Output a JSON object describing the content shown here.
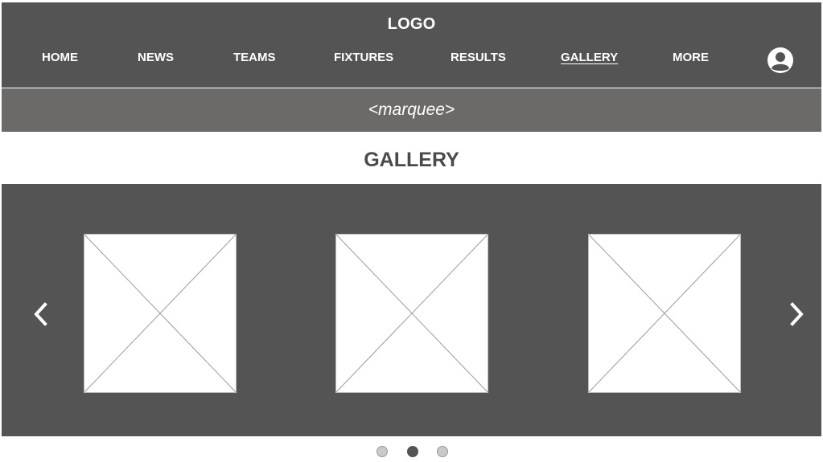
{
  "header": {
    "logo": "LOGO",
    "nav": [
      {
        "label": "HOME",
        "active": false
      },
      {
        "label": "NEWS",
        "active": false
      },
      {
        "label": "TEAMS",
        "active": false
      },
      {
        "label": "FIXTURES",
        "active": false
      },
      {
        "label": "RESULTS",
        "active": false
      },
      {
        "label": "GALLERY",
        "active": true
      },
      {
        "label": "MORE",
        "active": false
      }
    ],
    "user_icon": "user-avatar-icon"
  },
  "marquee": {
    "text": "<marquee>"
  },
  "page": {
    "title": "GALLERY"
  },
  "carousel": {
    "prev_icon": "chevron-left-icon",
    "next_icon": "chevron-right-icon",
    "slides": [
      {
        "icon": "image-placeholder-icon"
      },
      {
        "icon": "image-placeholder-icon"
      },
      {
        "icon": "image-placeholder-icon"
      }
    ],
    "pagination": {
      "count": 3,
      "active_index": 1
    }
  },
  "colors": {
    "header_bg": "#545454",
    "marquee_bg": "#6b6a68",
    "title_text": "#4a4a4a",
    "dot_inactive": "#c9c9c9",
    "dot_active": "#545454"
  }
}
